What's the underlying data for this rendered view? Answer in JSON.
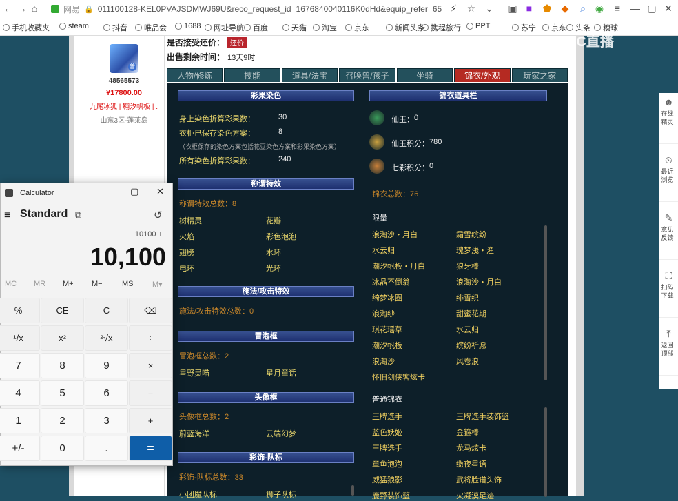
{
  "browser": {
    "site_label": "网易",
    "url": "011100128-KEL0PVAJSDMWJ69U&reco_request_id=1676840040116K0dHd&equip_refer=65",
    "bookmarks": [
      "手机收藏夹",
      "steam",
      "抖音",
      "唯品会",
      "1688",
      "网址导航",
      "百度",
      "天猫",
      "淘宝",
      "京东",
      "新闻头条",
      "携程旅行",
      "PPT",
      "苏宁",
      "京东",
      "头条",
      "糗球"
    ]
  },
  "seller": {
    "id": "48565573",
    "price": "¥17800.00",
    "item_name": "九尾冰狐 | 翱汐帆板 | ...",
    "server": "山东3区-蓬莱岛",
    "avatar_badge": "普"
  },
  "header": {
    "bargain_label": "是否接受还价：",
    "bargain_button": "还价",
    "remain_label": "出售剩余时间：",
    "remain_value": "13天9时"
  },
  "tabs": [
    "人物/修炼",
    "技能",
    "道具/法宝",
    "召唤兽/孩子",
    "坐骑",
    "锦衣/外观",
    "玩家之家"
  ],
  "left": {
    "dye_title": "彩果染色",
    "dye_rows": [
      {
        "label": "身上染色折算彩果数：",
        "value": "30"
      },
      {
        "label": "衣柜已保存染色方案：",
        "value": "8"
      }
    ],
    "dye_note": "（衣柜保存的染色方案包括花豆染色方案和彩果染色方案）",
    "dye_total": {
      "label": "所有染色折算彩果数：",
      "value": "240"
    },
    "title_fx": "称谓特效",
    "title_fx_total": "称谓特效总数：8",
    "title_fx_items": [
      "树精灵",
      "花瓣",
      "火焰",
      "彩色泡泡",
      "翅膀",
      "水环",
      "电环",
      "光环"
    ],
    "spell_title": "施法/攻击特效",
    "spell_total": "施法/攻击特效总数：0",
    "bubble_title": "冒泡框",
    "bubble_total": "冒泡框总数：2",
    "bubble_items": [
      "星野灵喵",
      "星月童话"
    ],
    "frame_title": "头像框",
    "frame_total": "头像框总数：2",
    "frame_items": [
      "蔚蓝海洋",
      "云端幻梦"
    ],
    "team_title": "彩饰-队标",
    "team_total": "彩饰-队标总数：33",
    "team_items": [
      "小团魔队标",
      "狮子队标"
    ]
  },
  "right": {
    "title": "锦衣道具栏",
    "res": [
      {
        "label": "仙玉：",
        "value": "0"
      },
      {
        "label": "仙玉积分：",
        "value": "780"
      },
      {
        "label": "七彩积分：",
        "value": "0"
      }
    ],
    "total": "锦衣总数：76",
    "limited_title": "限量",
    "limited_items": [
      "浪淘沙・月白",
      "霜雪缤纷",
      "水云归",
      "瑰梦浅・渔",
      "潮汐帆板・月白",
      "狼牙棒",
      "冰晶不倒翁",
      "浪淘沙・月白",
      "绮梦冰圈",
      "绯雪织",
      "浪淘纱",
      "甜蜜花期",
      "琪花瑶草",
      "水云归",
      "潮汐帆板",
      "缤纷祈愿",
      "浪淘沙",
      "风卷浪",
      "怀旧剑侠客炫卡"
    ],
    "normal_title": "普通锦衣",
    "normal_items": [
      "王牌选手",
      "王牌选手装饰篮",
      "蓝色妖姬",
      "金箍棒",
      "王牌选手",
      "龙马炫卡",
      "章鱼泡泡",
      "缴夜星语",
      "威猛狼影",
      "武将脸谱头饰",
      "鹿野装饰篮",
      "火凝漠足迹"
    ]
  },
  "sidebar": [
    "在线精灵",
    "最近浏览",
    "意见反馈",
    "扫码下载",
    "返回顶部"
  ],
  "watermark": "CC直播",
  "calculator": {
    "title": "Calculator",
    "mode": "Standard",
    "expression": "10100 +",
    "display": "10,100",
    "memory": [
      "MC",
      "MR",
      "M+",
      "M−",
      "MS",
      "M▾"
    ],
    "keys": [
      "%",
      "CE",
      "C",
      "⌫",
      "¹/x",
      "x²",
      "²√x",
      "÷",
      "7",
      "8",
      "9",
      "×",
      "4",
      "5",
      "6",
      "−",
      "1",
      "2",
      "3",
      "+",
      "+/-",
      "0",
      ".",
      "="
    ]
  }
}
